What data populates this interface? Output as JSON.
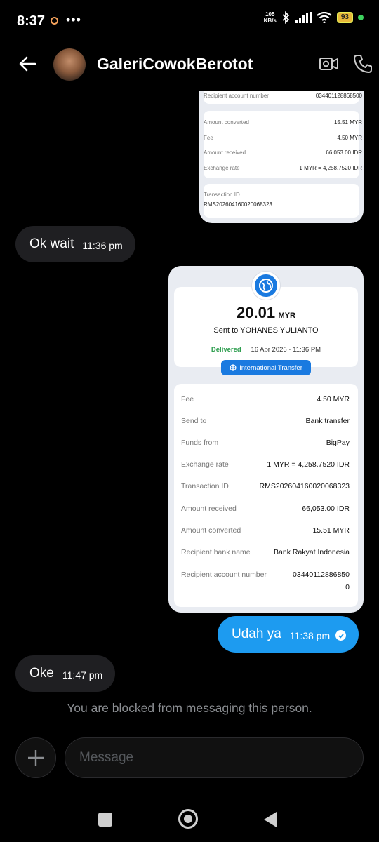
{
  "status_bar": {
    "time": "8:37",
    "more": "•••",
    "net_speed_value": "105",
    "net_speed_unit": "KB/s",
    "battery": "93"
  },
  "header": {
    "contact_name": "GaleriCowokBerotot",
    "icons": [
      "back-arrow-icon",
      "video-camera-icon",
      "phone-icon"
    ]
  },
  "receipt_top": {
    "partial_label": "Recipient account number",
    "partial_value": "034401128868500",
    "rows": [
      {
        "label": "Amount converted",
        "value": "15.51 MYR"
      },
      {
        "label": "Fee",
        "value": "4.50 MYR"
      },
      {
        "label": "Amount received",
        "value": "66,053.00 IDR"
      },
      {
        "label": "Exchange rate",
        "value": "1 MYR = 4,258.7520 IDR"
      }
    ],
    "txn_label": "Transaction ID",
    "txn_value": "RMS202604160020068323"
  },
  "receipt_main": {
    "amount": "20.01",
    "currency": "MYR",
    "sent_to": "Sent to YOHANES YULIANTO",
    "status": "Delivered",
    "separator": "|",
    "datetime": "16 Apr 2026 · 11:36 PM",
    "pill_label": "International Transfer",
    "rows": [
      {
        "label": "Fee",
        "value": "4.50 MYR"
      },
      {
        "label": "Send to",
        "value": "Bank transfer"
      },
      {
        "label": "Funds from",
        "value": "BigPay"
      },
      {
        "label": "Exchange rate",
        "value": "1 MYR = 4,258.7520 IDR"
      },
      {
        "label": "Transaction ID",
        "value": "RMS202604160020068323"
      },
      {
        "label": "Amount received",
        "value": "66,053.00 IDR"
      },
      {
        "label": "Amount converted",
        "value": "15.51 MYR"
      },
      {
        "label": "Recipient bank name",
        "value": "Bank Rakyat Indonesia"
      },
      {
        "label": "Recipient account number",
        "value": "03440112886850"
      }
    ],
    "last_value_wrap": "0"
  },
  "messages": [
    {
      "text": "Ok wait",
      "time": "11:36 pm",
      "direction": "incoming"
    },
    {
      "text": "Udah ya",
      "time": "11:38 pm",
      "direction": "outgoing"
    },
    {
      "text": "Oke",
      "time": "11:47 pm",
      "direction": "incoming"
    }
  ],
  "blocked_notice": "You are blocked from messaging this person.",
  "composer": {
    "placeholder": "Message"
  },
  "colors": {
    "accent": "#1d9bf0",
    "incoming_bubble": "#1f1f22",
    "delivered": "#2e9e4f",
    "transfer_blue": "#1a7ae0"
  }
}
